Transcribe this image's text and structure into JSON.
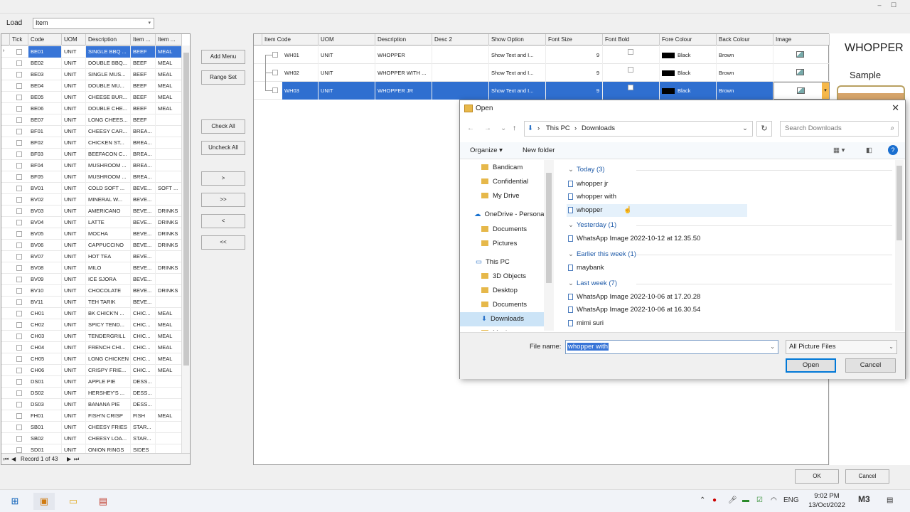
{
  "window_controls": {
    "minimize": "–",
    "maximize": "☐"
  },
  "load": {
    "label": "Load",
    "value": "Item"
  },
  "left_grid": {
    "columns": [
      "Tick",
      "Code",
      "UOM",
      "Description",
      "Item ...",
      "Item ..."
    ],
    "rows": [
      {
        "code": "BE01",
        "uom": "UNIT",
        "desc": "SINGLE BBQ ...",
        "cat1": "BEEF",
        "cat2": "MEAL"
      },
      {
        "code": "BE02",
        "uom": "UNIT",
        "desc": "DOUBLE BBQ...",
        "cat1": "BEEF",
        "cat2": "MEAL"
      },
      {
        "code": "BE03",
        "uom": "UNIT",
        "desc": "SINGLE MUS...",
        "cat1": "BEEF",
        "cat2": "MEAL"
      },
      {
        "code": "BE04",
        "uom": "UNIT",
        "desc": "DOUBLE MU...",
        "cat1": "BEEF",
        "cat2": "MEAL"
      },
      {
        "code": "BE05",
        "uom": "UNIT",
        "desc": "CHEESE BUR...",
        "cat1": "BEEF",
        "cat2": "MEAL"
      },
      {
        "code": "BE06",
        "uom": "UNIT",
        "desc": "DOUBLE CHE...",
        "cat1": "BEEF",
        "cat2": "MEAL"
      },
      {
        "code": "BE07",
        "uom": "UNIT",
        "desc": "LONG CHEES...",
        "cat1": "BEEF",
        "cat2": ""
      },
      {
        "code": "BF01",
        "uom": "UNIT",
        "desc": "CHEESY CAR...",
        "cat1": "BREA...",
        "cat2": ""
      },
      {
        "code": "BF02",
        "uom": "UNIT",
        "desc": "CHICKEN ST...",
        "cat1": "BREA...",
        "cat2": ""
      },
      {
        "code": "BF03",
        "uom": "UNIT",
        "desc": "BEEFACON C...",
        "cat1": "BREA...",
        "cat2": ""
      },
      {
        "code": "BF04",
        "uom": "UNIT",
        "desc": "MUSHROOM ...",
        "cat1": "BREA...",
        "cat2": ""
      },
      {
        "code": "BF05",
        "uom": "UNIT",
        "desc": "MUSHROOM ...",
        "cat1": "BREA...",
        "cat2": ""
      },
      {
        "code": "BV01",
        "uom": "UNIT",
        "desc": "COLD SOFT ...",
        "cat1": "BEVE...",
        "cat2": "SOFT ..."
      },
      {
        "code": "BV02",
        "uom": "UNIT",
        "desc": "MINERAL W...",
        "cat1": "BEVE...",
        "cat2": ""
      },
      {
        "code": "BV03",
        "uom": "UNIT",
        "desc": "AMERICANO",
        "cat1": "BEVE...",
        "cat2": "DRINKS"
      },
      {
        "code": "BV04",
        "uom": "UNIT",
        "desc": "LATTE",
        "cat1": "BEVE...",
        "cat2": "DRINKS"
      },
      {
        "code": "BV05",
        "uom": "UNIT",
        "desc": "MOCHA",
        "cat1": "BEVE...",
        "cat2": "DRINKS"
      },
      {
        "code": "BV06",
        "uom": "UNIT",
        "desc": "CAPPUCCINO",
        "cat1": "BEVE...",
        "cat2": "DRINKS"
      },
      {
        "code": "BV07",
        "uom": "UNIT",
        "desc": "HOT TEA",
        "cat1": "BEVE...",
        "cat2": ""
      },
      {
        "code": "BV08",
        "uom": "UNIT",
        "desc": "MILO",
        "cat1": "BEVE...",
        "cat2": "DRINKS"
      },
      {
        "code": "BV09",
        "uom": "UNIT",
        "desc": "ICE SJORA",
        "cat1": "BEVE...",
        "cat2": ""
      },
      {
        "code": "BV10",
        "uom": "UNIT",
        "desc": "CHOCOLATE",
        "cat1": "BEVE...",
        "cat2": "DRINKS"
      },
      {
        "code": "BV11",
        "uom": "UNIT",
        "desc": "TEH TARIK",
        "cat1": "BEVE...",
        "cat2": ""
      },
      {
        "code": "CH01",
        "uom": "UNIT",
        "desc": "BK CHICK'N ...",
        "cat1": "CHIC...",
        "cat2": "MEAL"
      },
      {
        "code": "CH02",
        "uom": "UNIT",
        "desc": "SPICY TEND...",
        "cat1": "CHIC...",
        "cat2": "MEAL"
      },
      {
        "code": "CH03",
        "uom": "UNIT",
        "desc": "TENDERGRILL",
        "cat1": "CHIC...",
        "cat2": "MEAL"
      },
      {
        "code": "CH04",
        "uom": "UNIT",
        "desc": "FRENCH CHI...",
        "cat1": "CHIC...",
        "cat2": "MEAL"
      },
      {
        "code": "CH05",
        "uom": "UNIT",
        "desc": "LONG CHICKEN",
        "cat1": "CHIC...",
        "cat2": "MEAL"
      },
      {
        "code": "CH06",
        "uom": "UNIT",
        "desc": "CRISPY FRIE...",
        "cat1": "CHIC...",
        "cat2": "MEAL"
      },
      {
        "code": "DS01",
        "uom": "UNIT",
        "desc": "APPLE PIE",
        "cat1": "DESS...",
        "cat2": ""
      },
      {
        "code": "DS02",
        "uom": "UNIT",
        "desc": "HERSHEY'S ...",
        "cat1": "DESS...",
        "cat2": ""
      },
      {
        "code": "DS03",
        "uom": "UNIT",
        "desc": "BANANA PIE",
        "cat1": "DESS...",
        "cat2": ""
      },
      {
        "code": "FH01",
        "uom": "UNIT",
        "desc": "FISH'N CRISP",
        "cat1": "FISH",
        "cat2": "MEAL"
      },
      {
        "code": "SB01",
        "uom": "UNIT",
        "desc": "CHEESY FRIES",
        "cat1": "STAR...",
        "cat2": ""
      },
      {
        "code": "SB02",
        "uom": "UNIT",
        "desc": "CHEESY LOA...",
        "cat1": "STAR...",
        "cat2": ""
      },
      {
        "code": "SD01",
        "uom": "UNIT",
        "desc": "ONION RINGS",
        "cat1": "SIDES",
        "cat2": ""
      }
    ],
    "record_text": "Record 1 of 43"
  },
  "buttons": {
    "add_menu": "Add Menu",
    "range_set": "Range Set",
    "check_all": "Check All",
    "uncheck_all": "Uncheck All",
    "move_right": ">",
    "move_all_right": ">>",
    "move_left": "<",
    "move_all_left": "<<"
  },
  "right_grid": {
    "columns": [
      "Item Code",
      "UOM",
      "Description",
      "Desc 2",
      "Show Option",
      "Font Size",
      "Font Bold",
      "Fore Colour",
      "Back Colour",
      "Image"
    ],
    "rows": [
      {
        "code": "WH01",
        "uom": "UNIT",
        "desc": "WHOPPER",
        "desc2": "",
        "show": "Show Text and I...",
        "size": "9",
        "fore": "Black",
        "back": "Brown"
      },
      {
        "code": "WH02",
        "uom": "UNIT",
        "desc": "WHOPPER WITH ...",
        "desc2": "",
        "show": "Show Text and I...",
        "size": "9",
        "fore": "Black",
        "back": "Brown"
      },
      {
        "code": "WH03",
        "uom": "UNIT",
        "desc": "WHOPPER JR",
        "desc2": "",
        "show": "Show Text and I...",
        "size": "9",
        "fore": "Black",
        "back": "Brown"
      }
    ]
  },
  "preview": {
    "title": "WHOPPER",
    "sample": "Sample"
  },
  "dialog": {
    "title": "Open",
    "breadcrumb": [
      "This PC",
      "Downloads"
    ],
    "search_placeholder": "Search Downloads",
    "organize": "Organize ▾",
    "new_folder": "New folder",
    "tree": [
      {
        "label": "Bandicam"
      },
      {
        "label": "Confidential"
      },
      {
        "label": "My Drive"
      },
      {
        "label": "OneDrive - Persona"
      },
      {
        "label": "Documents"
      },
      {
        "label": "Pictures"
      },
      {
        "label": "This PC"
      },
      {
        "label": "3D Objects"
      },
      {
        "label": "Desktop"
      },
      {
        "label": "Documents"
      },
      {
        "label": "Downloads"
      },
      {
        "label": "Music"
      }
    ],
    "groups": [
      {
        "label": "Today (3)",
        "files": [
          "whopper jr",
          "whopper with",
          "whopper"
        ]
      },
      {
        "label": "Yesterday (1)",
        "files": [
          "WhatsApp Image 2022-10-12 at 12.35.50"
        ]
      },
      {
        "label": "Earlier this week (1)",
        "files": [
          "maybank"
        ]
      },
      {
        "label": "Last week (7)",
        "files": [
          "WhatsApp Image 2022-10-06 at 17.20.28",
          "WhatsApp Image 2022-10-06 at 16.30.54",
          "mimi suri"
        ]
      }
    ],
    "file_name_label": "File name:",
    "file_name_value": "whopper with",
    "file_type": "All Picture Files",
    "open": "Open",
    "cancel": "Cancel"
  },
  "footer": {
    "ok": "OK",
    "cancel": "Cancel"
  },
  "taskbar": {
    "lang": "ENG",
    "time": "9:02 PM",
    "date": "13/Oct/2022"
  }
}
